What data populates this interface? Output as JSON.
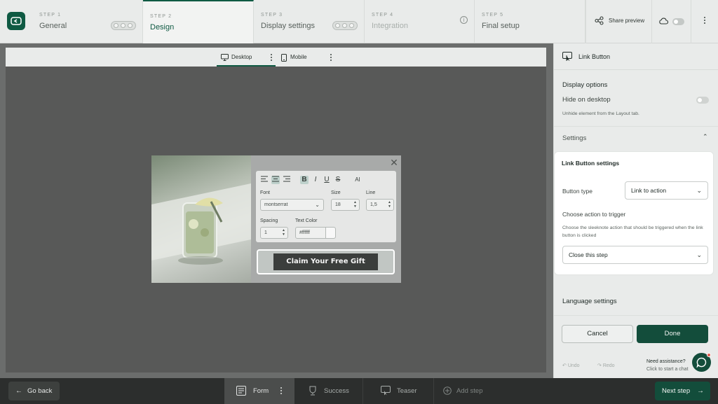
{
  "steps": [
    {
      "num": "STEP 1",
      "name": "General"
    },
    {
      "num": "STEP 2",
      "name": "Design"
    },
    {
      "num": "STEP 3",
      "name": "Display settings"
    },
    {
      "num": "STEP 4",
      "name": "Integration"
    },
    {
      "num": "STEP 5",
      "name": "Final setup"
    }
  ],
  "header": {
    "share_label": "Share preview",
    "info_icon": "i"
  },
  "device_tabs": {
    "desktop": "Desktop",
    "mobile": "Mobile"
  },
  "editor": {
    "font_label": "Font",
    "font_value": "montserrat",
    "size_label": "Size",
    "size_value": "18",
    "line_label": "Line",
    "line_value": "1,5",
    "spacing_label": "Spacing",
    "spacing_value": "1",
    "text_color_label": "Text Color",
    "text_color_value": "#ffffff",
    "ai_label": "AI",
    "bold": "B",
    "italic": "I",
    "underline": "U",
    "strike": "S"
  },
  "popup": {
    "cta_label": "Claim Your Free Gift",
    "close": "✕"
  },
  "panel": {
    "title": "Link Button",
    "display_options": "Display options",
    "hide_on_desktop": "Hide on desktop",
    "unhide_hint": "Unhide element from the Layout tab.",
    "settings": "Settings",
    "card_title": "Link Button settings",
    "button_type_label": "Button type",
    "button_type_value": "Link to action",
    "choose_action_label": "Choose action to trigger",
    "choose_action_desc": "Choose the sleeknote action that should be triggered when the link button is clicked",
    "action_value": "Close this step",
    "language_settings": "Language settings",
    "cancel": "Cancel",
    "done": "Done",
    "undo": "Undo",
    "redo": "Redo",
    "assist_title": "Need assistance?",
    "assist_sub": "Click to start a chat"
  },
  "bottom": {
    "go_back": "Go back",
    "form": "Form",
    "success": "Success",
    "teaser": "Teaser",
    "add_step": "Add step",
    "next_step": "Next step"
  },
  "colors": {
    "brand": "#134d3b",
    "accent": "#0f5a43",
    "toggle_off": "#c4c8c6"
  }
}
